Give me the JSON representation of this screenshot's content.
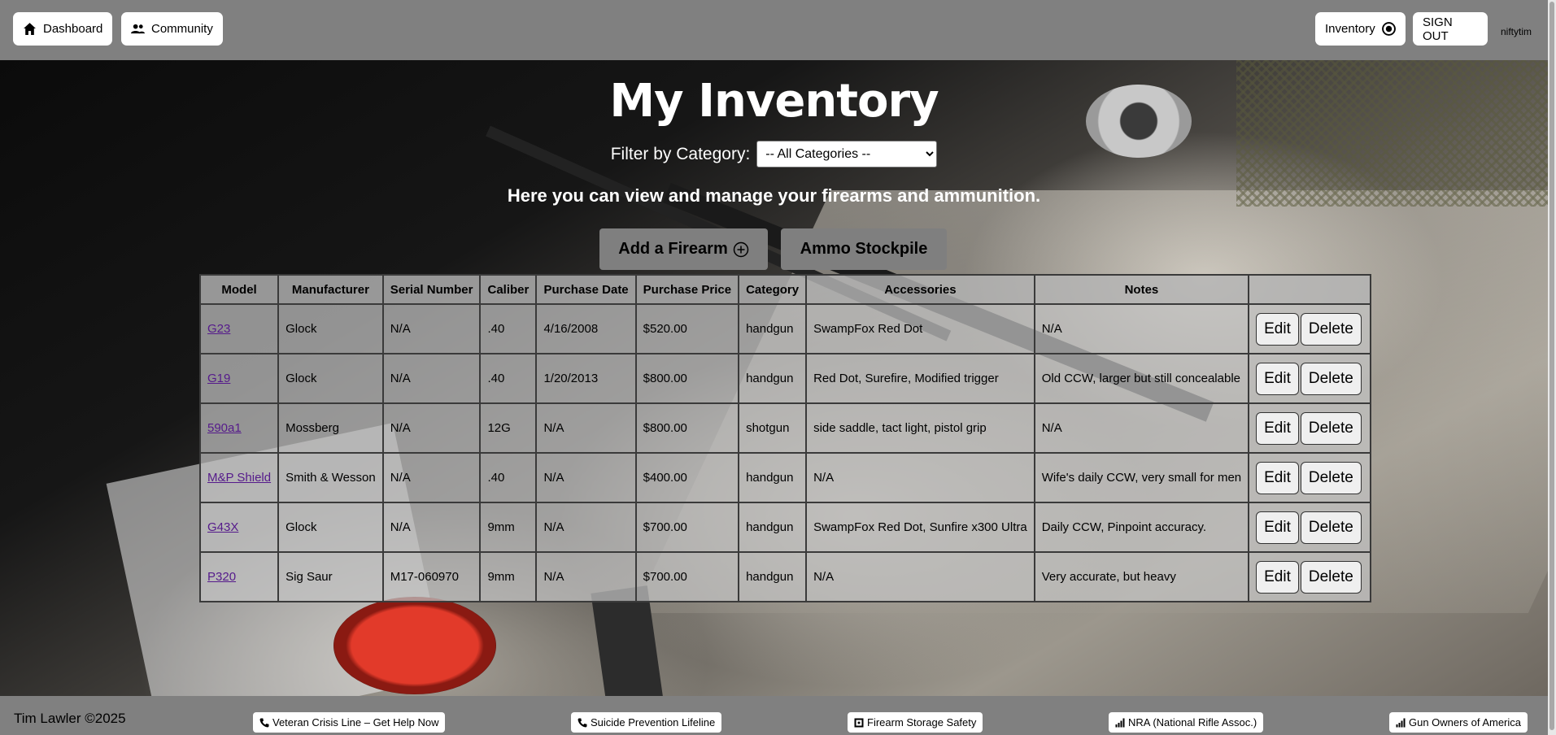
{
  "nav": {
    "dashboard_label": "Dashboard",
    "community_label": "Community",
    "inventory_label": "Inventory",
    "signout_label": "SIGN OUT",
    "username": "niftytim"
  },
  "main": {
    "title": "My Inventory",
    "filter_label": "Filter by Category:",
    "filter_selected": "-- All Categories --",
    "subtitle": "Here you can view and manage your firearms and ammunition.",
    "add_firearm_label": "Add a Firearm",
    "ammo_label": "Ammo Stockpile"
  },
  "table": {
    "headers": [
      "Model",
      "Manufacturer",
      "Serial Number",
      "Caliber",
      "Purchase Date",
      "Purchase Price",
      "Category",
      "Accessories",
      "Notes",
      ""
    ],
    "edit_label": "Edit",
    "delete_label": "Delete",
    "rows": [
      {
        "model": "G23",
        "manufacturer": "Glock",
        "serial": "N/A",
        "caliber": ".40",
        "purchase_date": "4/16/2008",
        "price": "$520.00",
        "category": "handgun",
        "accessories": "SwampFox Red Dot",
        "notes": "N/A"
      },
      {
        "model": "G19",
        "manufacturer": "Glock",
        "serial": "N/A",
        "caliber": ".40",
        "purchase_date": "1/20/2013",
        "price": "$800.00",
        "category": "handgun",
        "accessories": "Red Dot, Surefire, Modified trigger",
        "notes": "Old CCW, larger but still concealable"
      },
      {
        "model": "590a1",
        "manufacturer": "Mossberg",
        "serial": "N/A",
        "caliber": "12G",
        "purchase_date": "N/A",
        "price": "$800.00",
        "category": "shotgun",
        "accessories": "side saddle, tact light, pistol grip",
        "notes": "N/A"
      },
      {
        "model": "M&P Shield",
        "manufacturer": "Smith & Wesson",
        "serial": "N/A",
        "caliber": ".40",
        "purchase_date": "N/A",
        "price": "$400.00",
        "category": "handgun",
        "accessories": "N/A",
        "notes": "Wife's daily CCW, very small for men"
      },
      {
        "model": "G43X",
        "manufacturer": "Glock",
        "serial": "N/A",
        "caliber": "9mm",
        "purchase_date": "N/A",
        "price": "$700.00",
        "category": "handgun",
        "accessories": "SwampFox Red Dot, Sunfire x300 Ultra",
        "notes": "Daily CCW, Pinpoint accuracy."
      },
      {
        "model": "P320",
        "manufacturer": "Sig Saur",
        "serial": "M17-060970",
        "caliber": "9mm",
        "purchase_date": "N/A",
        "price": "$700.00",
        "category": "handgun",
        "accessories": "N/A",
        "notes": "Very accurate, but heavy"
      }
    ]
  },
  "footer": {
    "copyright": "Tim Lawler ©2025",
    "links": [
      {
        "label": "Veteran Crisis Line – Get Help Now",
        "icon": "phone-icon"
      },
      {
        "label": "Suicide Prevention Lifeline",
        "icon": "phone-icon"
      },
      {
        "label": "Firearm Storage Safety",
        "icon": "safe-icon"
      },
      {
        "label": "NRA (National Rifle Assoc.)",
        "icon": "signal-icon"
      },
      {
        "label": "Gun Owners of America",
        "icon": "signal-icon"
      }
    ]
  }
}
